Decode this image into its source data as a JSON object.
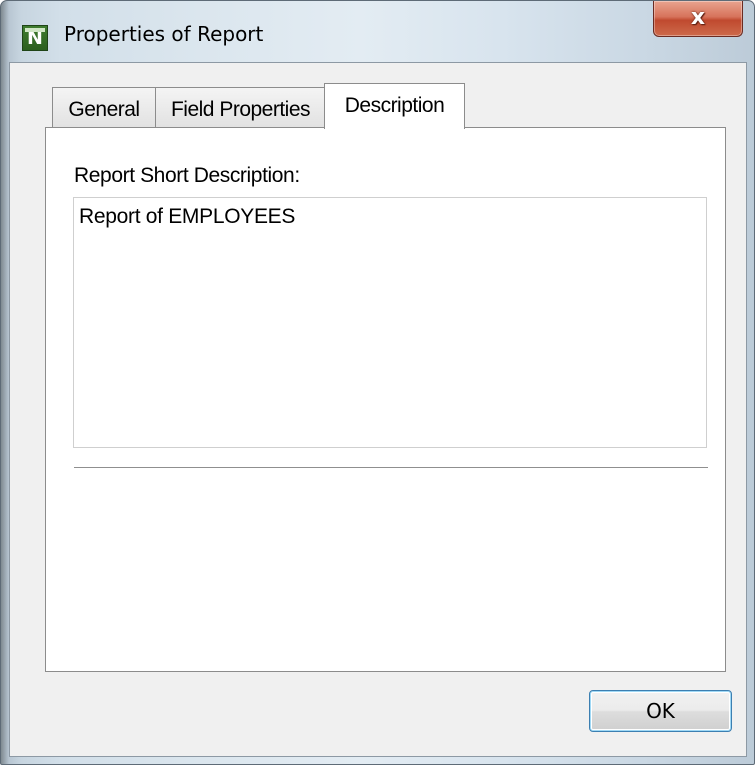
{
  "window": {
    "title": "Properties of Report",
    "icon_letter": "N",
    "close_label": "x"
  },
  "tabs": [
    {
      "label": "General",
      "active": false
    },
    {
      "label": "Field Properties",
      "active": false
    },
    {
      "label": "Description",
      "active": true
    }
  ],
  "description": {
    "label": "Report Short Description:",
    "value": "Report of EMPLOYEES"
  },
  "buttons": {
    "ok_label": "OK"
  },
  "colors": {
    "close_button": "#c94a30",
    "app_icon": "#2c5f1f",
    "ok_focus_border": "#3c7fb1"
  }
}
